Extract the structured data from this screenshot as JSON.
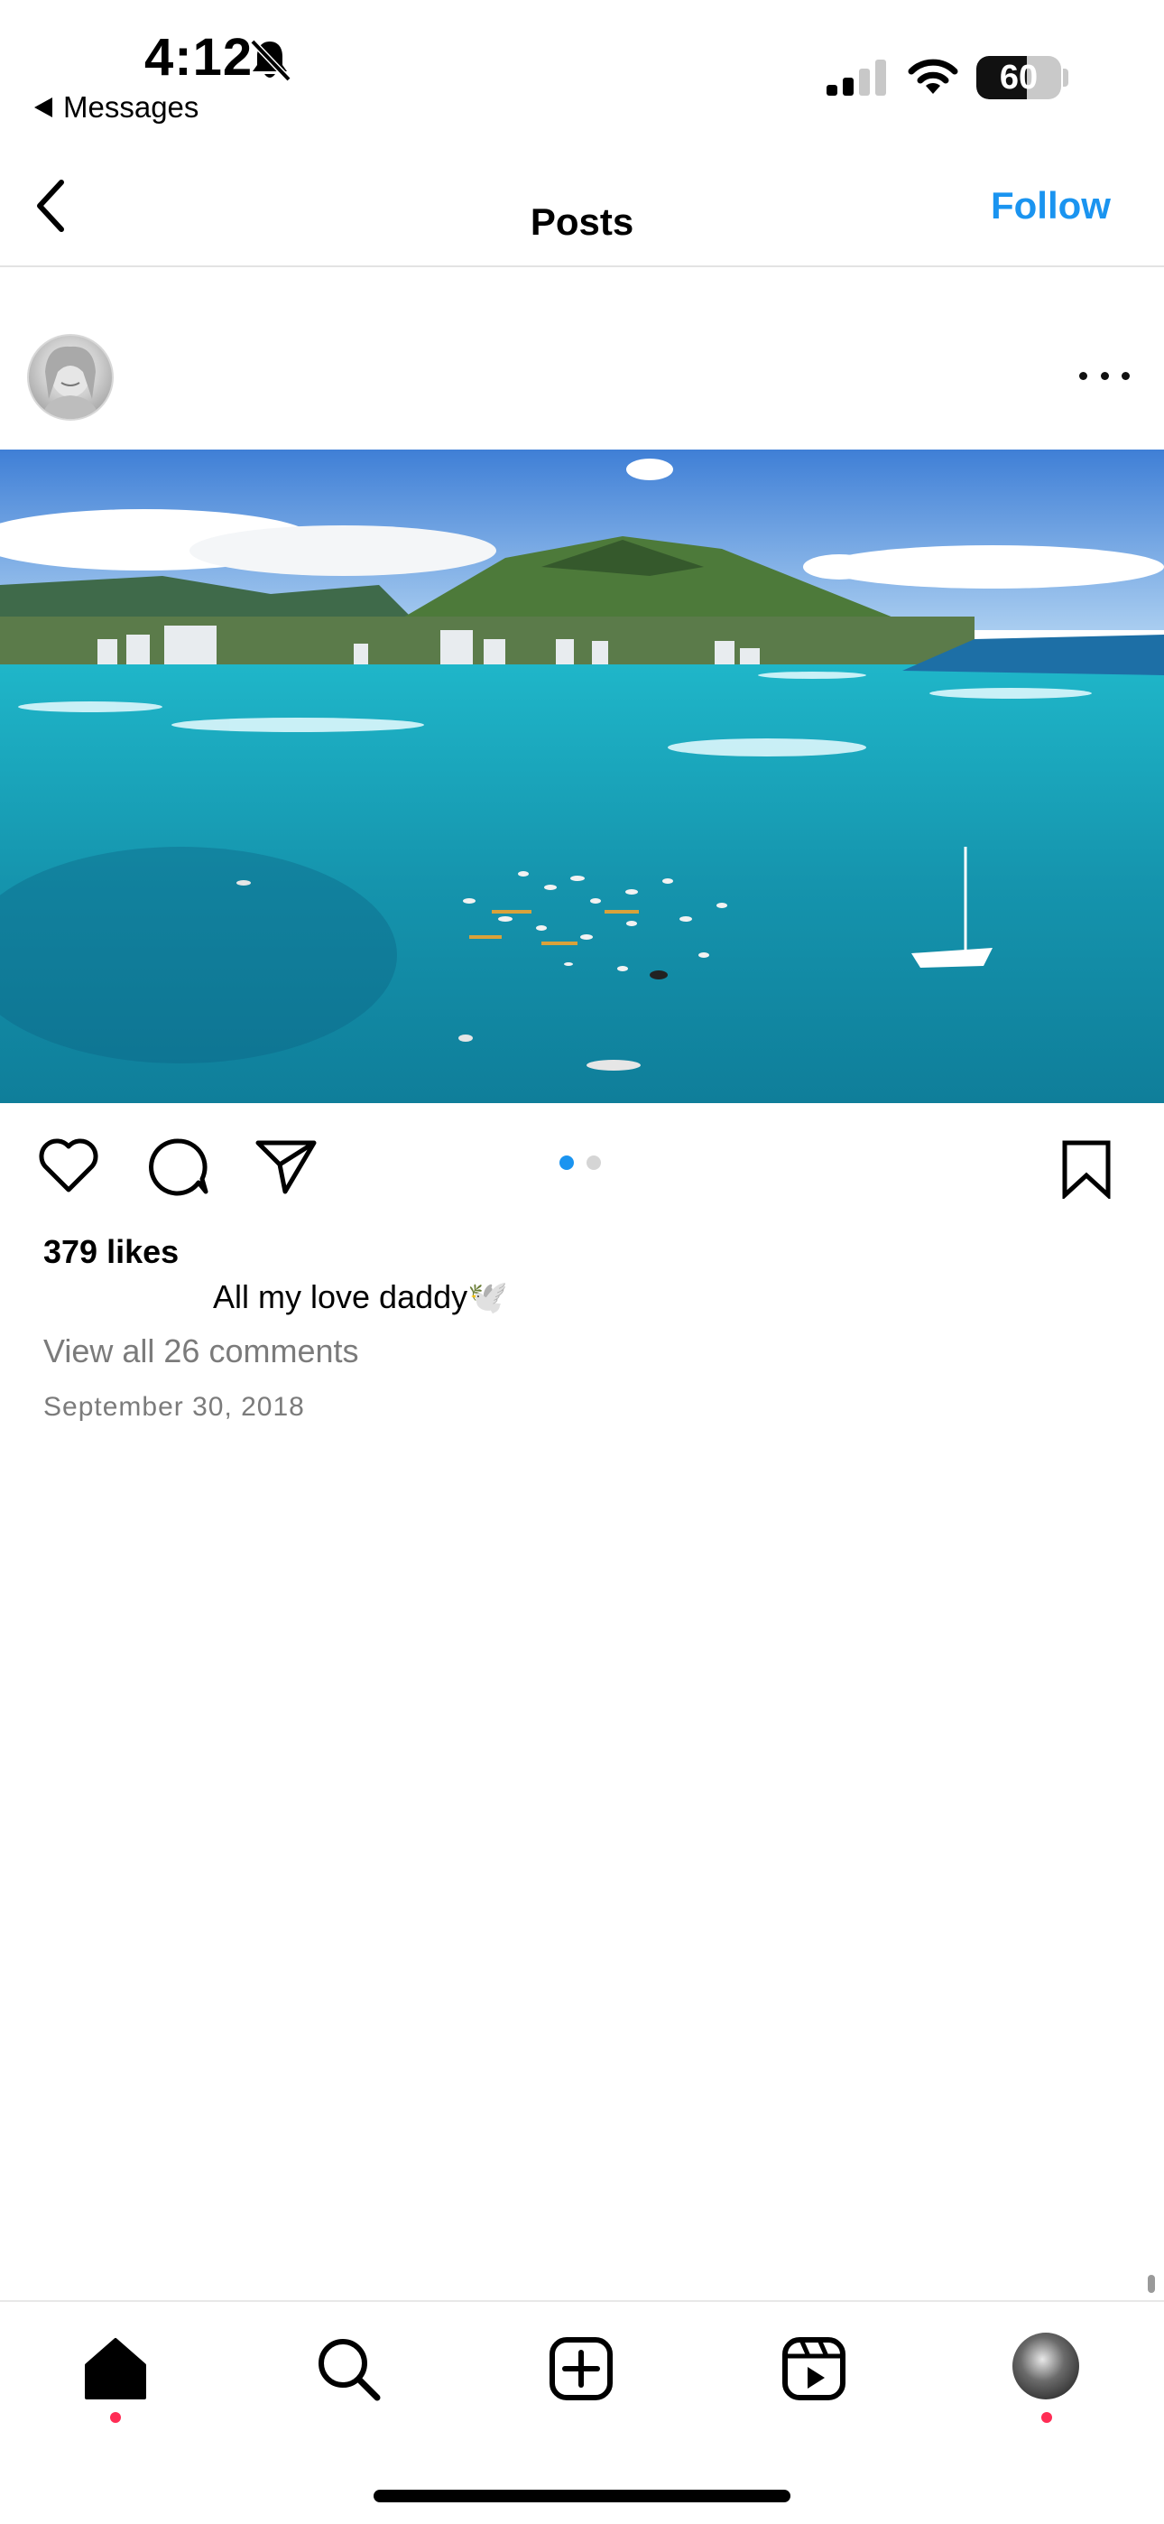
{
  "status_bar": {
    "time": "4:12",
    "back_label": "Messages",
    "battery": "60",
    "battery_level": 0.6
  },
  "nav": {
    "title": "Posts",
    "follow_label": "Follow"
  },
  "post": {
    "likes": "379 likes",
    "caption": "All my love daddy🕊️",
    "view_comments": "View all 26 comments",
    "date": "September 30, 2018",
    "carousel": {
      "count": 2,
      "active_index": 0
    }
  },
  "tabs": [
    "home",
    "search",
    "create",
    "reels",
    "profile"
  ],
  "colors": {
    "accent": "#1a94f0",
    "notification": "#ff2d55"
  }
}
